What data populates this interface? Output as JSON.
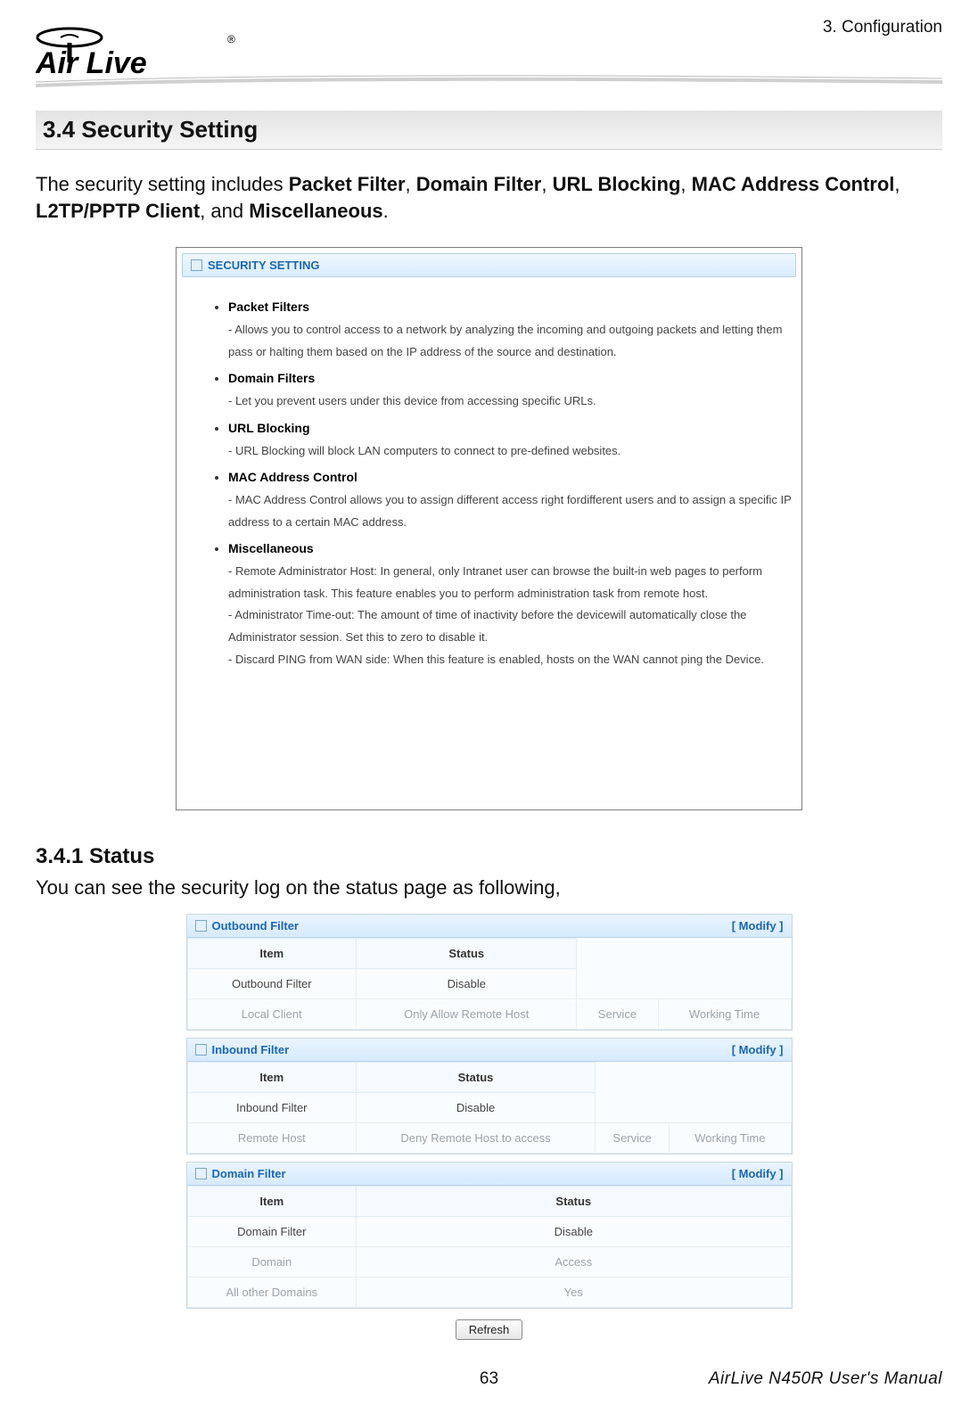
{
  "header": {
    "chapter": "3. Configuration",
    "logo_text": "Air Live",
    "logo_reg": "®"
  },
  "section": {
    "heading": "3.4 Security Setting",
    "intro_pre": "The security setting includes ",
    "intro_bold": [
      "Packet Filter",
      "Domain Filter",
      "URL Blocking",
      "MAC Address Control",
      "L2TP/PPTP Client",
      "Miscellaneous"
    ],
    "intro_joiners": [
      ", ",
      ", ",
      ", ",
      ", ",
      ", and ",
      "."
    ]
  },
  "panel1": {
    "title": "SECURITY SETTING",
    "items": [
      {
        "title": "Packet Filters",
        "desc": "- Allows you to control access to a network by analyzing the incoming and outgoing packets and letting them pass or halting them based on the IP address of the source and destination."
      },
      {
        "title": "Domain Filters",
        "desc": "- Let you prevent users under this device from accessing specific URLs."
      },
      {
        "title": "URL Blocking",
        "desc": "- URL Blocking will block LAN computers to connect to pre-defined websites."
      },
      {
        "title": "MAC Address Control",
        "desc": "- MAC Address Control allows you to assign different access right fordifferent users and to assign a specific IP address to a certain MAC address."
      },
      {
        "title": "Miscellaneous",
        "desc": "- Remote Administrator Host: In general, only Intranet user can browse the built-in web pages to perform administration task. This feature enables you to perform administration task from remote host.\n- Administrator Time-out: The amount of time of inactivity before the devicewill automatically close the Administrator session. Set this to zero to disable it.\n- Discard PING from WAN side: When this feature is enabled, hosts on the WAN cannot ping the Device."
      }
    ]
  },
  "sub": {
    "heading": "3.4.1 Status",
    "intro": "You can see the security log on the status page as following,"
  },
  "panel2": {
    "modify_label": "[ Modify ]",
    "blocks": [
      {
        "title": "Outbound Filter",
        "row1_headers": [
          "Item",
          "Status"
        ],
        "row1_values": [
          "Outbound Filter",
          "Disable"
        ],
        "row2": [
          "Local Client",
          "Only Allow Remote Host",
          "Service",
          "Working Time"
        ]
      },
      {
        "title": "Inbound Filter",
        "row1_headers": [
          "Item",
          "Status"
        ],
        "row1_values": [
          "Inbound Filter",
          "Disable"
        ],
        "row2": [
          "Remote Host",
          "Deny Remote Host to access",
          "Service",
          "Working Time"
        ]
      },
      {
        "title": "Domain Filter",
        "row1_headers": [
          "Item",
          "Status"
        ],
        "row1_values": [
          "Domain Filter",
          "Disable"
        ],
        "row2": [
          "Domain",
          "Access"
        ],
        "row3": [
          "All other Domains",
          "Yes"
        ]
      }
    ],
    "refresh": "Refresh"
  },
  "footer": {
    "page": "63",
    "doc": "AirLive N450R User's Manual"
  }
}
